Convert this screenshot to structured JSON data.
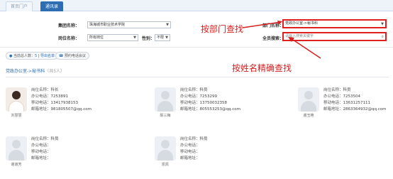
{
  "tabs": {
    "home": "首页门户",
    "address_book": "通讯录"
  },
  "filter": {
    "group_label": "集团名称：",
    "group_value": "珠海城市职业技术学院",
    "position_label": "岗位名称：",
    "position_value": "所有岗位",
    "gender_label": "性别：",
    "gender_value": "不限",
    "dept_label": "部门名称：",
    "dept_value": "党政办公室->秘书科",
    "search_label": "全员搜索：",
    "search_placeholder": "请输入搜索关键字"
  },
  "stats": {
    "total_label": "当前总人数：",
    "total_count": "5",
    "export_label": "导出名单",
    "reserve_label": "预约电话会议"
  },
  "department": {
    "path": "党政办公室->秘书科",
    "count": "（共5人）"
  },
  "field_labels": {
    "position": "岗位名称：",
    "office": "办公电话：",
    "mobile": "移动电话：",
    "email": "邮箱地址："
  },
  "contacts": [
    {
      "name": "刘慧慧",
      "position": "科长",
      "office": "7253891",
      "mobile": "13417938153",
      "email": "981805507@qq.com",
      "photo": true
    },
    {
      "name": "陈三梅",
      "position": "科员",
      "office": "7253299",
      "mobile": "13750032358",
      "email": "805553253@qq.com",
      "photo": false
    },
    {
      "name": "谢玉艳",
      "position": "科员",
      "office": "7253504",
      "mobile": "13631257111",
      "email": "2863364932@qq.com",
      "photo": false
    },
    {
      "name": "谢淑芳",
      "position": "科员",
      "office": "",
      "mobile": "",
      "email": "",
      "photo": false
    },
    {
      "name": "凯凯",
      "position": "科员",
      "office": "",
      "mobile": "",
      "email": "",
      "photo": false
    }
  ],
  "annotations": {
    "by_department": "按部门查找",
    "by_name": "按姓名精确查找"
  },
  "colors": {
    "accent": "#2f6db3",
    "annotation": "#d62020"
  }
}
